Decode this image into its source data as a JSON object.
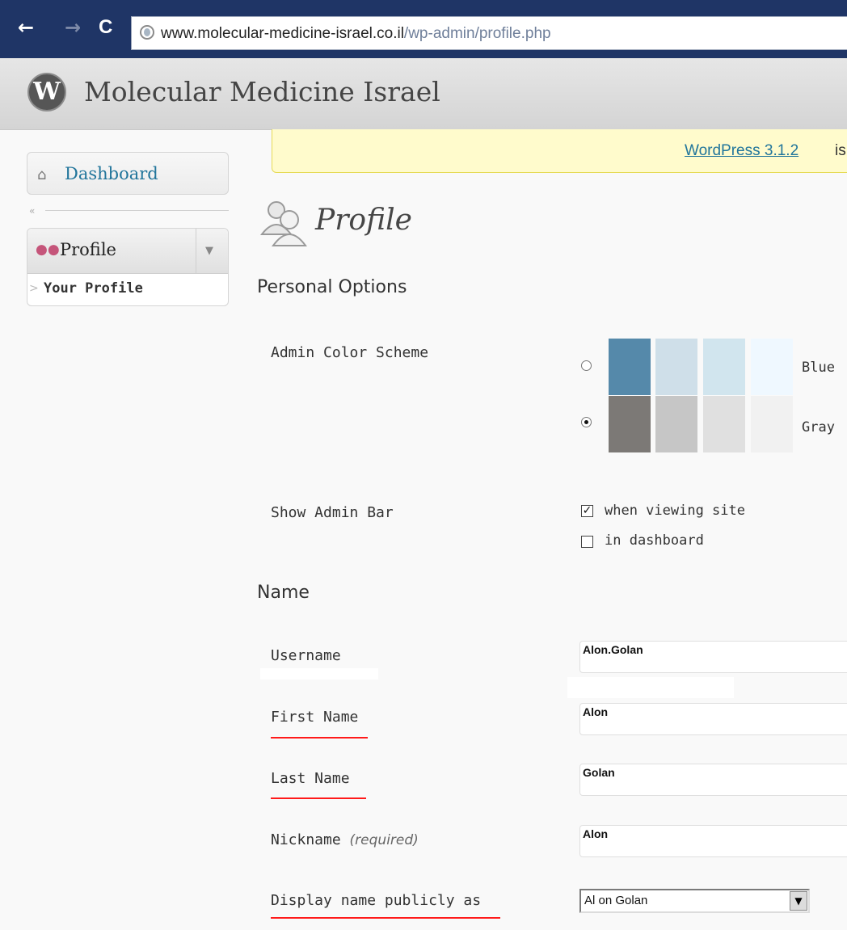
{
  "browser": {
    "url_host": "www.molecular-medicine-israel.co.il",
    "url_path": "/wp-admin/profile.php",
    "back": "←",
    "forward": "→",
    "reload": "C"
  },
  "header": {
    "logo": "W",
    "site_title": "Molecular Medicine Israel"
  },
  "sidebar": {
    "dashboard_label": "Dashboard",
    "collapse_glyph": "«",
    "profile_label": "Profile",
    "submenu_arrow": "▼",
    "your_profile_label": "Your Profile"
  },
  "notice": {
    "link_text": "WordPress 3.1.2",
    "trailing_text": "is"
  },
  "page": {
    "title": "Profile"
  },
  "personal_options": {
    "heading": "Personal Options",
    "color_scheme_label": "Admin Color Scheme",
    "schemes": [
      {
        "name": "Blue",
        "selected": false,
        "colors": [
          "#5589aa",
          "#cfdfe9",
          "#d1e5ee",
          "#eff8ff"
        ]
      },
      {
        "name": "Gray",
        "selected": true,
        "colors": [
          "#7c7976",
          "#c6c6c6",
          "#e0e0e0",
          "#f1f1f1"
        ]
      }
    ],
    "admin_bar_label": "Show Admin Bar",
    "admin_bar_options": [
      {
        "label": "when viewing site",
        "checked": true
      },
      {
        "label": "in dashboard",
        "checked": false
      }
    ]
  },
  "name_section": {
    "heading": "Name",
    "username_label": "Username",
    "username_value": "Alon.Golan",
    "first_name_label": "First Name",
    "first_name_value": "Alon",
    "last_name_label": "Last Name",
    "last_name_value": "Golan",
    "nickname_label": "Nickname",
    "nickname_required": "(required)",
    "nickname_value": "Alon",
    "display_name_label": "Display name publicly as",
    "display_name_value": "Al on Golan",
    "select_arrow": "▼"
  },
  "colors": {
    "link": "#21759b",
    "notice_bg": "#fffbcc",
    "annotation_underline": "#ff1a1a",
    "chrome": "#1f3566"
  }
}
